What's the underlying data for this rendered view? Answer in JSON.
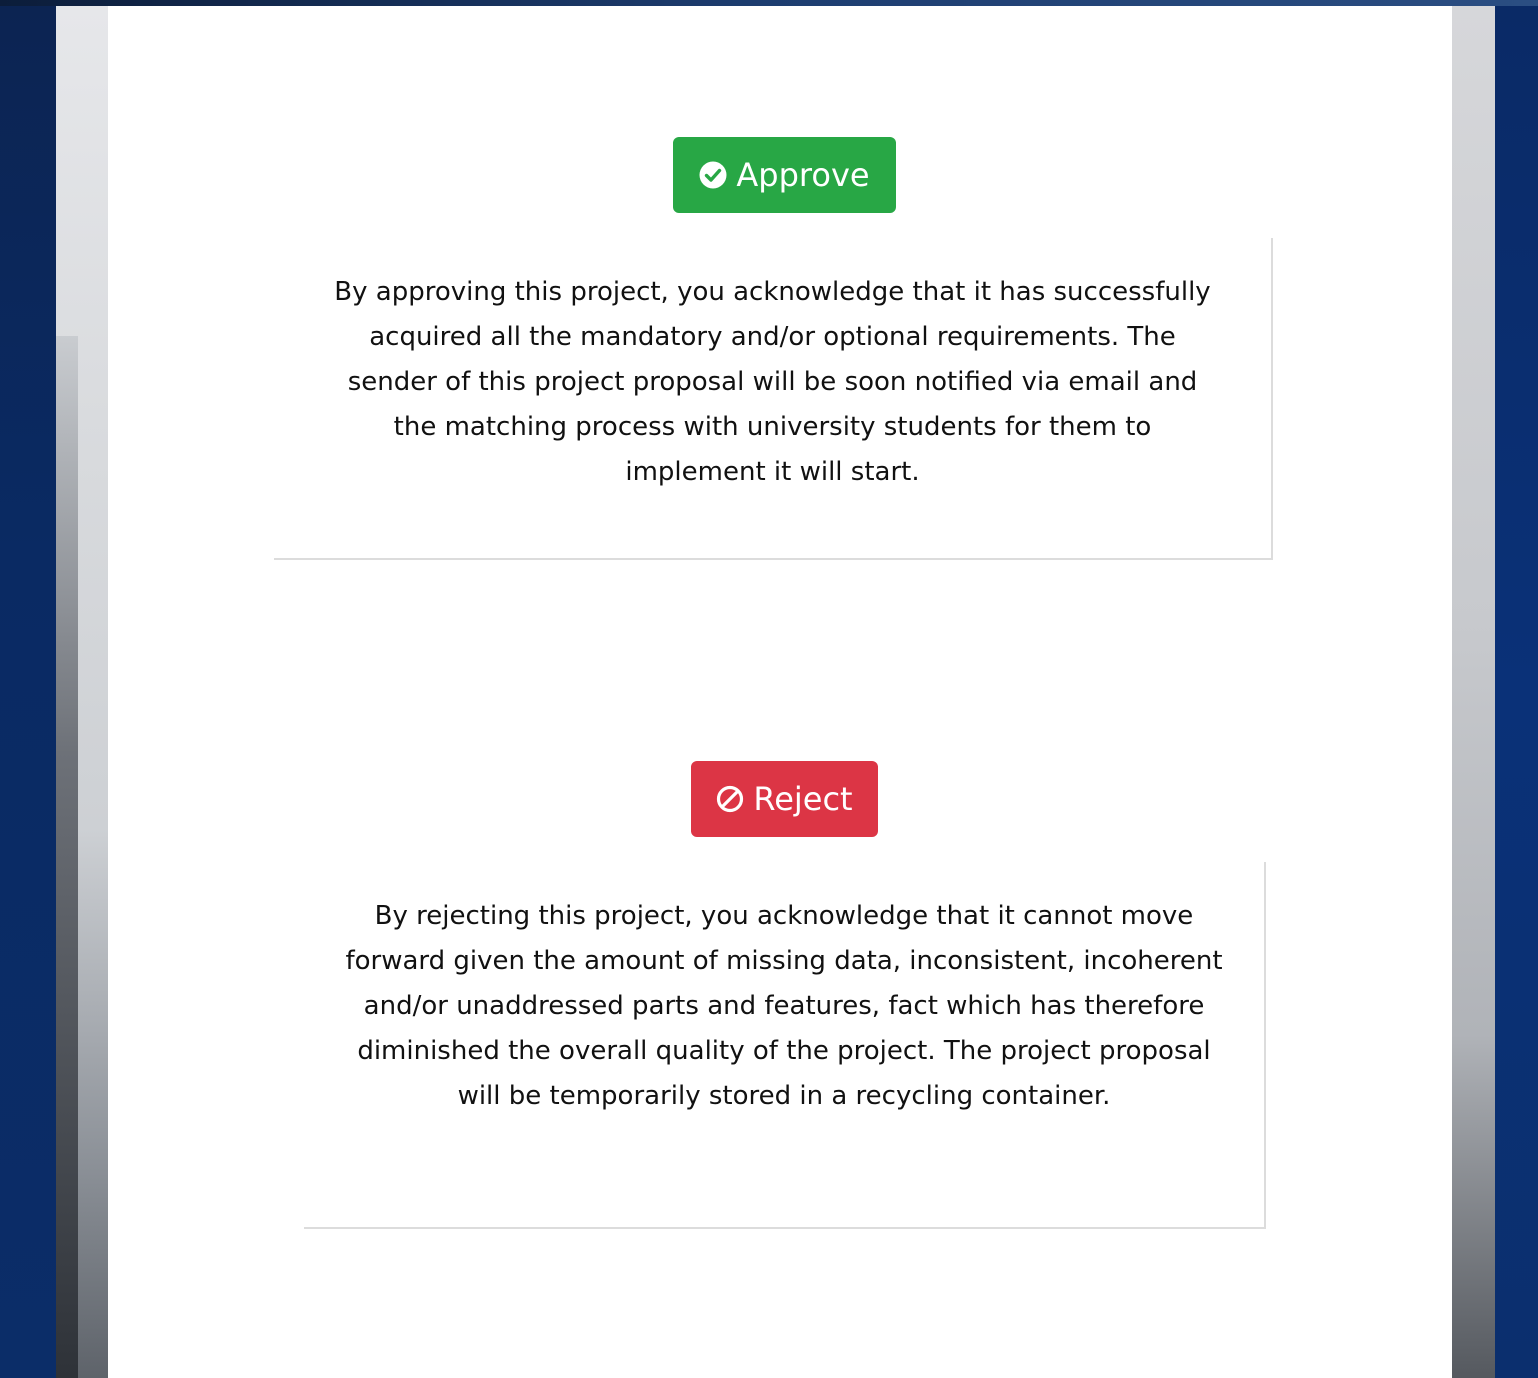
{
  "approve": {
    "icon": "check-circle-icon",
    "label": "Approve",
    "color": "#28a745",
    "description": "By approving this project, you acknowledge that it has successfully acquired all the mandatory and/or optional requirements. The sender of this project proposal will be soon notified via email and the matching process with university students for them to implement it will start."
  },
  "reject": {
    "icon": "ban-icon",
    "label": "Reject",
    "color": "#dc3545",
    "description": "By rejecting this project, you acknowledge that it cannot move forward given the amount of missing data, inconsistent, incoherent and/or unaddressed parts and features, fact which has therefore diminished the overall quality of the project. The project proposal will be temporarily stored in a recycling container."
  }
}
